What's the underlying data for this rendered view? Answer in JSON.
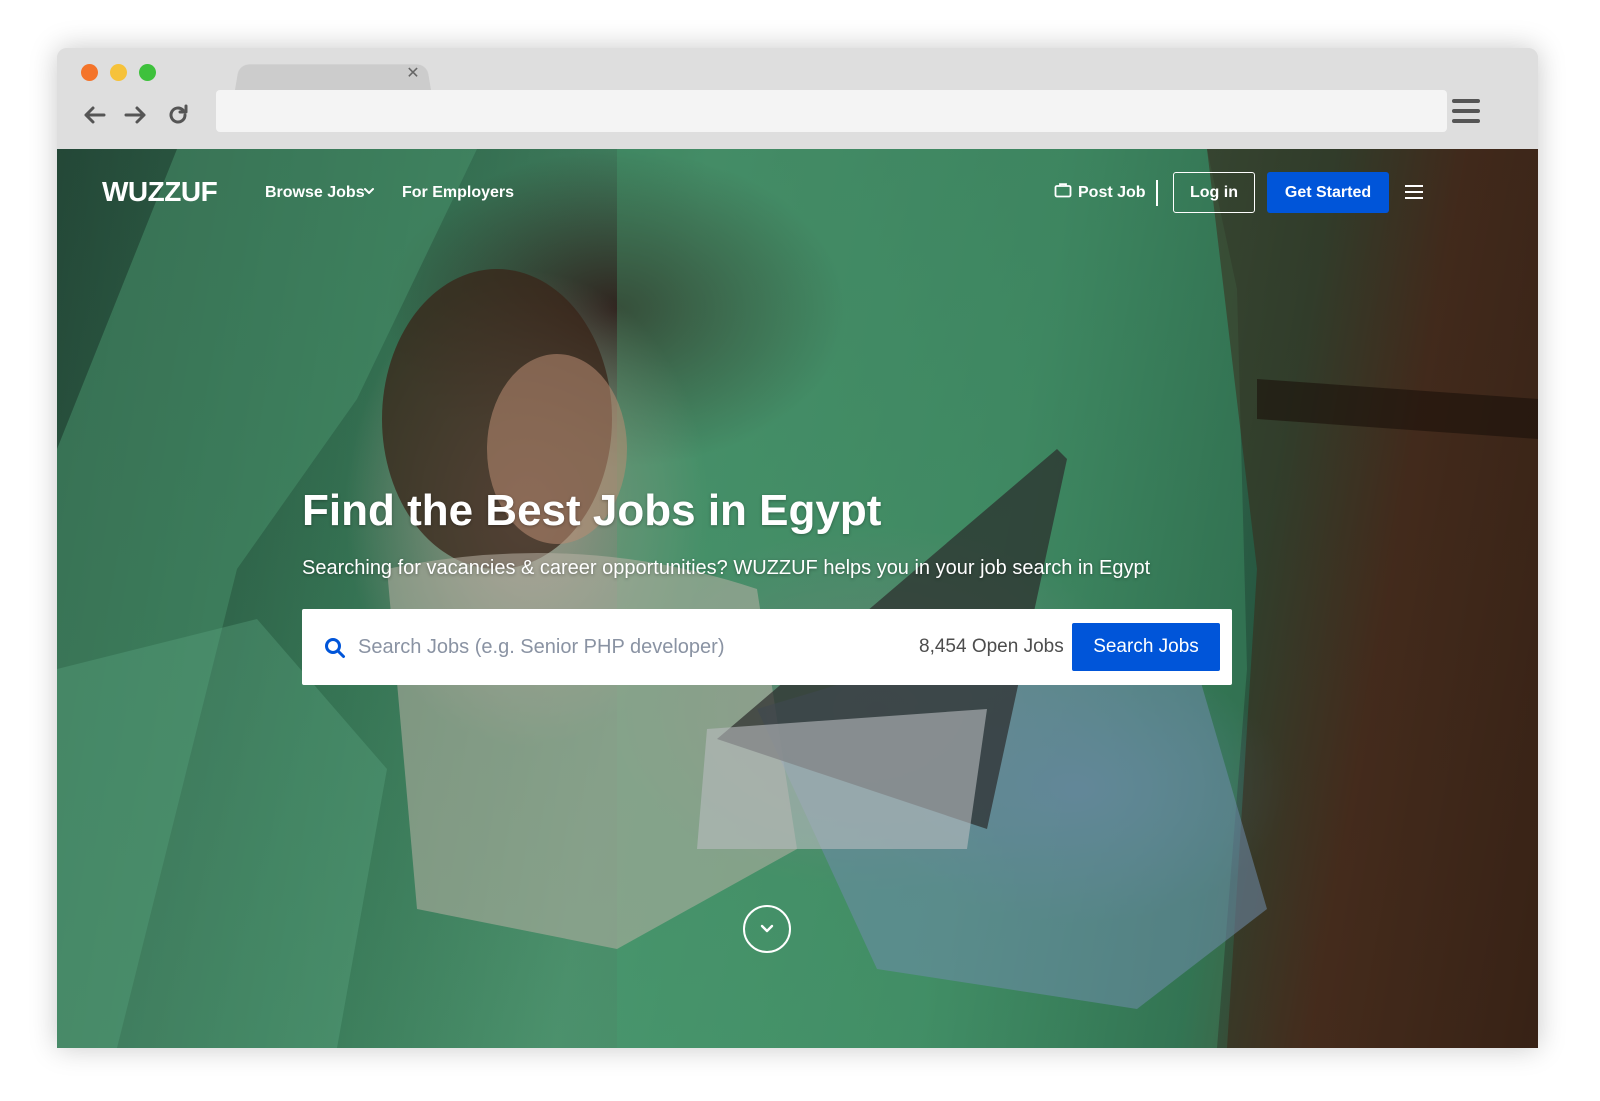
{
  "site": {
    "logo": "WUZZUF",
    "nav": {
      "browse_jobs": "Browse Jobs",
      "for_employers": "For Employers",
      "post_job": "Post Job",
      "login": "Log in",
      "get_started": "Get Started"
    }
  },
  "hero": {
    "title": "Find the Best Jobs in Egypt",
    "subtitle": "Searching for vacancies & career opportunities? WUZZUF helps you in your job search in Egypt",
    "search": {
      "placeholder": "Search Jobs (e.g. Senior PHP developer)",
      "open_jobs": "8,454 Open Jobs",
      "button": "Search Jobs"
    }
  },
  "colors": {
    "accent": "#0055d9",
    "traffic_red": "#f4742a",
    "traffic_yellow": "#f6c23a",
    "traffic_green": "#3ec13c"
  },
  "icons": {
    "back": "arrow-left-icon",
    "forward": "arrow-right-icon",
    "reload": "reload-icon",
    "tab_close": "close-icon",
    "browser_menu": "hamburger-icon",
    "browse_chevron": "chevron-down-icon",
    "post_job": "briefcase-icon",
    "site_menu": "menu-icon",
    "search": "search-icon",
    "scroll": "chevron-down-circle-icon"
  }
}
